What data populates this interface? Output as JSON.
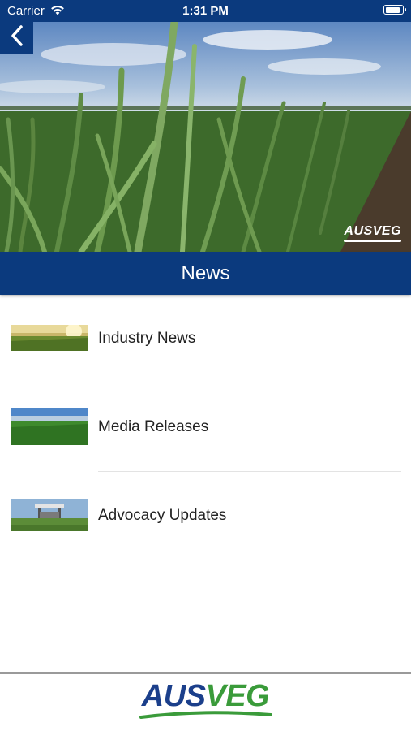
{
  "status_bar": {
    "carrier": "Carrier",
    "time": "1:31 PM",
    "battery_level": 0.9
  },
  "hero": {
    "logo_text": "AUSVEG",
    "back_icon": "chevron-left-icon"
  },
  "header": {
    "title": "News"
  },
  "news_items": [
    {
      "label": "Industry News",
      "thumb": "sunlit-crop-field"
    },
    {
      "label": "Media Releases",
      "thumb": "green-crop-rows"
    },
    {
      "label": "Advocacy Updates",
      "thumb": "farm-machinery-field"
    }
  ],
  "footer": {
    "logo_aus": "AUS",
    "logo_veg": "VEG"
  },
  "colors": {
    "brand_blue": "#0b3a7e",
    "brand_green": "#3a9b3a",
    "divider": "#e3e3e3"
  }
}
